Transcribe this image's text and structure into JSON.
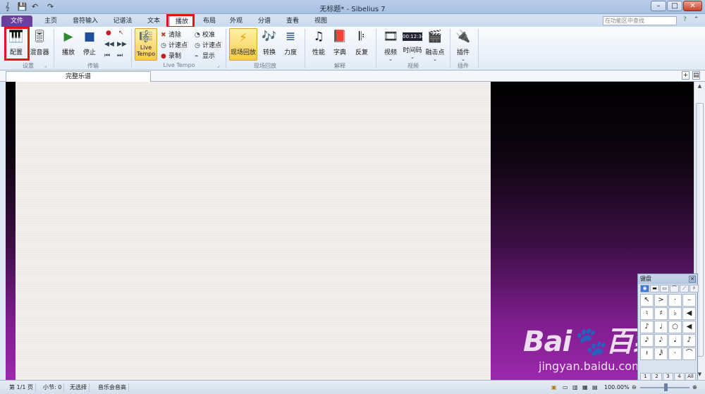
{
  "window": {
    "title": "无标题* - Sibelius 7",
    "minimize": "–",
    "maximize": "□",
    "close": "✕"
  },
  "quick_access": [
    "app-menu-icon",
    "save-icon",
    "undo-icon",
    "redo-icon"
  ],
  "tabs": [
    {
      "label": "文件"
    },
    {
      "label": "主页"
    },
    {
      "label": "音符输入"
    },
    {
      "label": "记谱法"
    },
    {
      "label": "文本"
    },
    {
      "label": "播放"
    },
    {
      "label": "布局"
    },
    {
      "label": "外观"
    },
    {
      "label": "分谱"
    },
    {
      "label": "查看"
    },
    {
      "label": "视图"
    }
  ],
  "ribbon_search": {
    "placeholder": "在功能区中查找"
  },
  "ribbon": {
    "setup": {
      "label": "设置",
      "config": "配置",
      "mixer": "混音器"
    },
    "transport": {
      "label": "传输",
      "play": "播放",
      "stop": "停止"
    },
    "live_tempo": {
      "label": "Live Tempo",
      "live_tempo_button": "Live\nTempo",
      "clear": "清除",
      "tap_points": "计速点",
      "record": "录制",
      "calibrate": "校准",
      "tap_points2": "计速点",
      "show": "显示"
    },
    "live_playback": {
      "label": "现场回放",
      "live_playback": "现场回放",
      "transform": "转换",
      "dynamics": "力度"
    },
    "interpretation": {
      "label": "解释",
      "performance": "性能",
      "dictionary": "字典",
      "repeat": "反复"
    },
    "video": {
      "label": "视频",
      "video": "视频",
      "timecode": "时间码",
      "hit_points": "融击点",
      "timecode_display": "00:12:34"
    },
    "plugins": {
      "label": "插件",
      "plugins": "插件"
    }
  },
  "document": {
    "tab": "完整乐谱"
  },
  "keypad": {
    "title": "键盘",
    "rows": [
      [
        "↖",
        ">",
        "·",
        "–"
      ],
      [
        "♮",
        "♯",
        "♭",
        "◀"
      ],
      [
        "♪",
        "♩",
        "○",
        "◀"
      ],
      [
        "𝅘𝅥𝅯",
        "𝅘𝅥𝅮",
        "𝅘𝅥",
        "♪"
      ],
      [
        "𝄽",
        "𝅘𝅥𝅱",
        "·",
        "⌒"
      ]
    ],
    "layouts": [
      "1",
      "2",
      "3",
      "4",
      "All"
    ]
  },
  "status": {
    "page": "第 1/1 页",
    "bar": "小节: 0",
    "selection": "无选择",
    "pitch": "音乐会音高",
    "zoom": "100.00%"
  },
  "watermark": {
    "logo": "Bai🐾百经验",
    "url": "jingyan.baidu.com"
  },
  "colors": {
    "file_tab": "#6b3f9a",
    "highlight": "#e3141a",
    "active_button": "#f6cb4c"
  }
}
